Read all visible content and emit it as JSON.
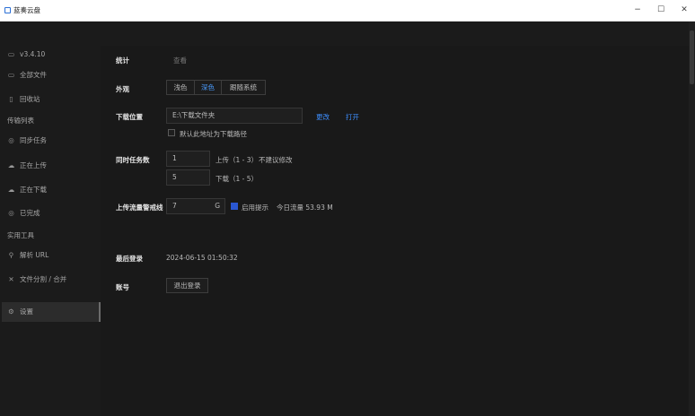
{
  "window": {
    "title": "蓝奏云盘",
    "minimize": "−",
    "maximize": "☐",
    "close": "✕"
  },
  "sidebar": {
    "version": "v3.4.10",
    "items": [
      {
        "label": "全部文件",
        "icon": "folder-icon"
      },
      {
        "label": "回收站",
        "icon": "trash-icon"
      },
      {
        "label": "传输列表",
        "icon": ""
      },
      {
        "label": "同步任务",
        "icon": "eye-icon"
      },
      {
        "label": "正在上传",
        "icon": "cloud-upload-icon"
      },
      {
        "label": "正在下载",
        "icon": "cloud-download-icon"
      },
      {
        "label": "已完成",
        "icon": "check-circle-icon"
      },
      {
        "label": "实用工具",
        "icon": ""
      },
      {
        "label": "解析 URL",
        "icon": "link-icon"
      },
      {
        "label": "文件分割 / 合并",
        "icon": "scissors-icon"
      },
      {
        "label": "设置",
        "icon": "gear-icon"
      }
    ]
  },
  "settings": {
    "stats": {
      "label": "统计",
      "value": "查看"
    },
    "appearance": {
      "label": "外观",
      "options": [
        "浅色",
        "深色",
        "跟随系统"
      ],
      "selected": "深色"
    },
    "download": {
      "label": "下载位置",
      "path": "E:\\下载文件夹",
      "change": "更改",
      "open": "打开",
      "default_checkbox": "默认此地址为下载路径"
    },
    "tasks": {
      "label": "同时任务数",
      "upload_value": "1",
      "upload_hint": "上传（1 - 3）",
      "upload_warning": "不建议修改",
      "download_value": "5",
      "download_hint": "下载（1 - 5）"
    },
    "traffic": {
      "label": "上传流量警戒线",
      "value": "7",
      "unit": "G",
      "enable_label": "启用提示",
      "today_label": "今日流量 53.93 M"
    },
    "last_login": {
      "label": "最后登录",
      "value": "2024-06-15 01:50:32"
    },
    "account": {
      "label": "账号",
      "logout": "退出登录"
    }
  }
}
